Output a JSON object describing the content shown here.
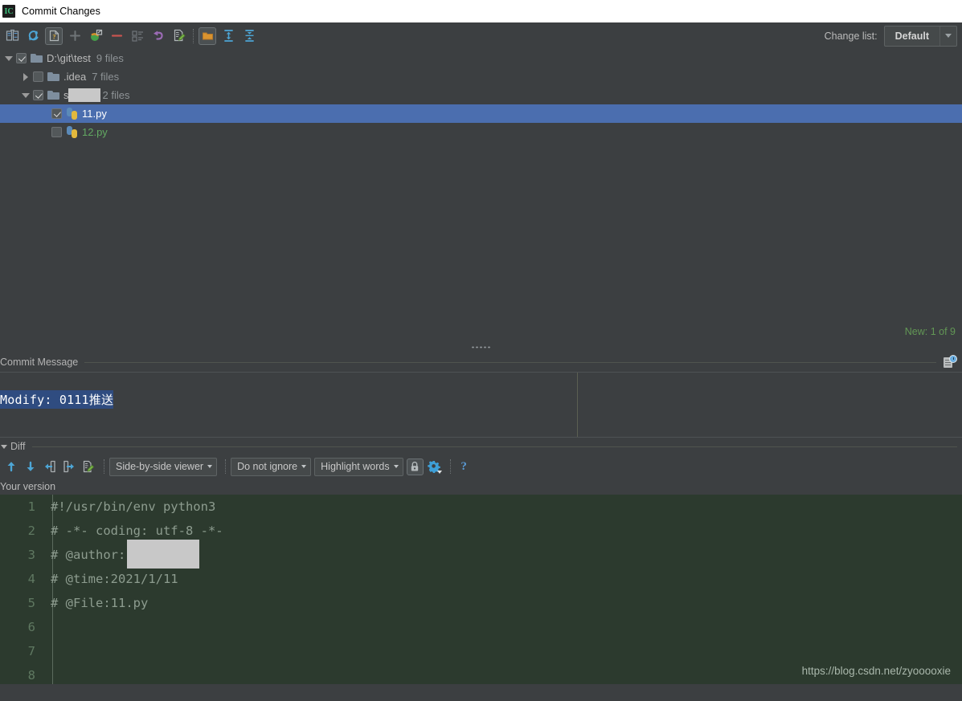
{
  "window": {
    "title": "Commit Changes",
    "app_icon": "intellij-idea-icon"
  },
  "toolbar": {
    "buttons": [
      {
        "name": "show-diff-icon",
        "enabled": true
      },
      {
        "name": "refresh-icon",
        "enabled": true
      },
      {
        "name": "show-unversioned-files-icon",
        "enabled": true,
        "active": true
      },
      {
        "name": "add-icon",
        "enabled": false
      },
      {
        "name": "revert-icon",
        "enabled": true
      },
      {
        "name": "remove-icon",
        "enabled": true
      },
      {
        "name": "group-by-icon",
        "enabled": false
      },
      {
        "name": "rollback-icon",
        "enabled": true
      },
      {
        "name": "edit-source-icon",
        "enabled": true
      },
      {
        "name": "show-directories-icon",
        "enabled": true,
        "active": true
      },
      {
        "name": "expand-all-icon",
        "enabled": true
      },
      {
        "name": "collapse-all-icon",
        "enabled": true
      }
    ],
    "changelist_label": "Change list:",
    "changelist_value": "Default"
  },
  "tree": {
    "rows": [
      {
        "name": "D:\\git\\test",
        "count": "9 files",
        "expanded": true,
        "has_toggle": true,
        "checkbox": "checked",
        "icon": "folder-icon",
        "indent": 0,
        "selected": false,
        "redacted": false,
        "green": false
      },
      {
        "name": ".idea",
        "count": "7 files",
        "expanded": false,
        "has_toggle": true,
        "checkbox": "unchecked",
        "icon": "folder-icon",
        "indent": 1,
        "selected": false,
        "redacted": false,
        "green": false
      },
      {
        "name": "s",
        "count": "2 files",
        "expanded": true,
        "has_toggle": true,
        "checkbox": "checked",
        "icon": "folder-icon",
        "indent": 1,
        "selected": false,
        "redacted": true,
        "green": false
      },
      {
        "name": "11.py",
        "count": "",
        "expanded": false,
        "has_toggle": false,
        "checkbox": "checked",
        "icon": "python-file-icon",
        "indent": 2,
        "selected": true,
        "redacted": false,
        "green": false
      },
      {
        "name": "12.py",
        "count": "",
        "expanded": false,
        "has_toggle": false,
        "checkbox": "unchecked",
        "icon": "python-file-icon",
        "indent": 2,
        "selected": false,
        "redacted": false,
        "green": true
      }
    ]
  },
  "status": {
    "text": "New: 1 of 9",
    "color": "#629755"
  },
  "commit_message": {
    "label": "Commit Message",
    "value": "Modify: 0111推送",
    "history_icon": "commit-history-icon"
  },
  "diff": {
    "section_title": "Diff",
    "nav_buttons": [
      {
        "name": "previous-difference-icon"
      },
      {
        "name": "next-difference-icon"
      },
      {
        "name": "accept-left-icon"
      },
      {
        "name": "accept-right-icon"
      },
      {
        "name": "edit-source-icon"
      }
    ],
    "viewer_mode": "Side-by-side viewer",
    "ignore_mode": "Do not ignore",
    "highlight_mode": "Highlight words",
    "lock_icon": "lock-icon",
    "settings_icon": "gear-icon",
    "help_icon": "help-icon",
    "pane_label": "Your version"
  },
  "code": {
    "lines": [
      {
        "number": "1",
        "text": "#!/usr/bin/env python3",
        "redacted_after": null
      },
      {
        "number": "2",
        "text": "# -*- coding: utf-8 -*-",
        "redacted_after": null
      },
      {
        "number": "3",
        "text": "# @author:",
        "redacted_after": true
      },
      {
        "number": "4",
        "text": "# @time:2021/1/11",
        "redacted_after": null
      },
      {
        "number": "5",
        "text": "# @File:11.py",
        "redacted_after": null
      },
      {
        "number": "6",
        "text": "",
        "redacted_after": null
      },
      {
        "number": "7",
        "text": "",
        "redacted_after": null
      },
      {
        "number": "8",
        "text": "",
        "redacted_after": null
      }
    ]
  },
  "watermark": {
    "text": "https://blog.csdn.net/zyooooxie"
  }
}
